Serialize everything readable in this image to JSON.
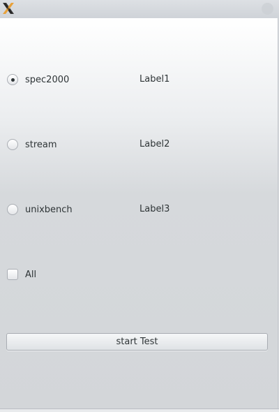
{
  "window": {
    "app_icon": "x11-logo-icon",
    "close_icon": "close-icon"
  },
  "options": [
    {
      "label": "spec2000",
      "checked": true,
      "side_label": "Label1"
    },
    {
      "label": "stream",
      "checked": false,
      "side_label": "Label2"
    },
    {
      "label": "unixbench",
      "checked": false,
      "side_label": "Label3"
    }
  ],
  "all_checkbox": {
    "label": "All",
    "checked": false
  },
  "start_button": {
    "label": "start Test"
  }
}
